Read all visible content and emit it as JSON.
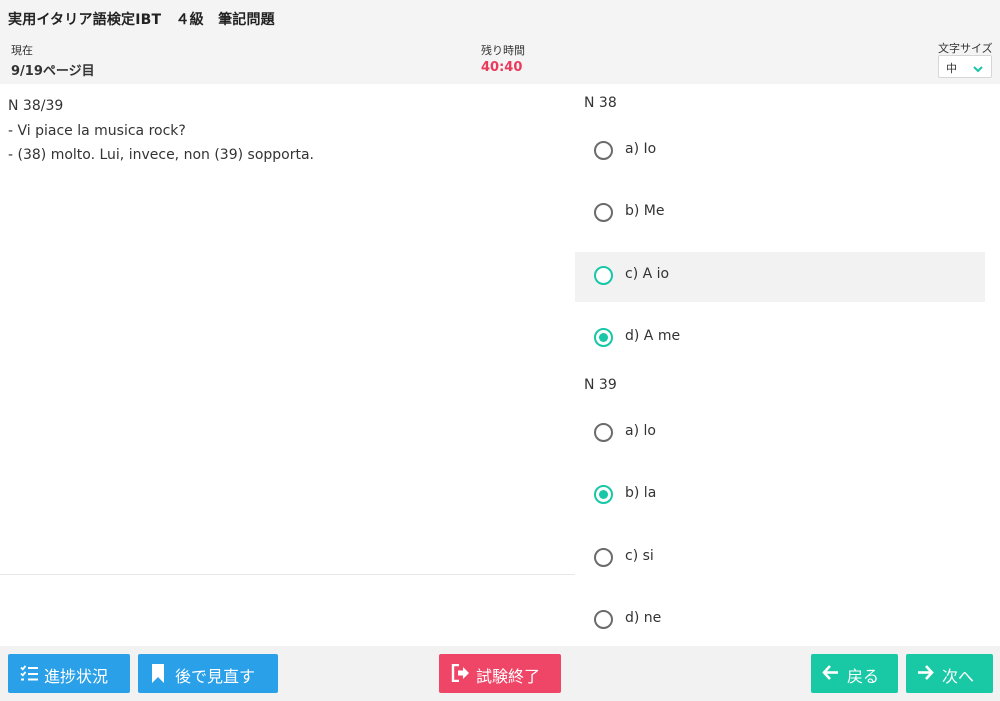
{
  "header": {
    "title": "実用イタリア語検定IBT　４級　筆記問題",
    "current_label": "現在",
    "current_value": "9/19ページ目",
    "time_label": "残り時間",
    "time_value": "40:40",
    "fontsize_label": "文字サイズ",
    "fontsize_value": "中"
  },
  "passage": {
    "lines": [
      "N 38/39",
      "- Vi piace la musica rock?",
      "- (38) molto. Lui, invece, non (39) sopporta."
    ]
  },
  "questions": [
    {
      "title": "N 38",
      "options": [
        {
          "label": "a) Io",
          "selected": false
        },
        {
          "label": "b) Me",
          "selected": false
        },
        {
          "label": "c) A io",
          "selected": false,
          "hovered": true
        },
        {
          "label": "d) A me",
          "selected": true
        }
      ]
    },
    {
      "title": "N 39",
      "options": [
        {
          "label": "a) lo",
          "selected": false
        },
        {
          "label": "b) la",
          "selected": true
        },
        {
          "label": "c) si",
          "selected": false
        },
        {
          "label": "d) ne",
          "selected": false
        }
      ]
    }
  ],
  "footer": {
    "progress_label": "進捗状況",
    "review_label": "後で見直す",
    "end_label": "試験終了",
    "back_label": "戻る",
    "next_label": "次へ"
  },
  "colors": {
    "accent": "#17c7a7",
    "timer": "#ea3a5c",
    "blue_button": "#2aa0e8",
    "red_button": "#ef4668",
    "teal_button": "#19c8a4"
  }
}
